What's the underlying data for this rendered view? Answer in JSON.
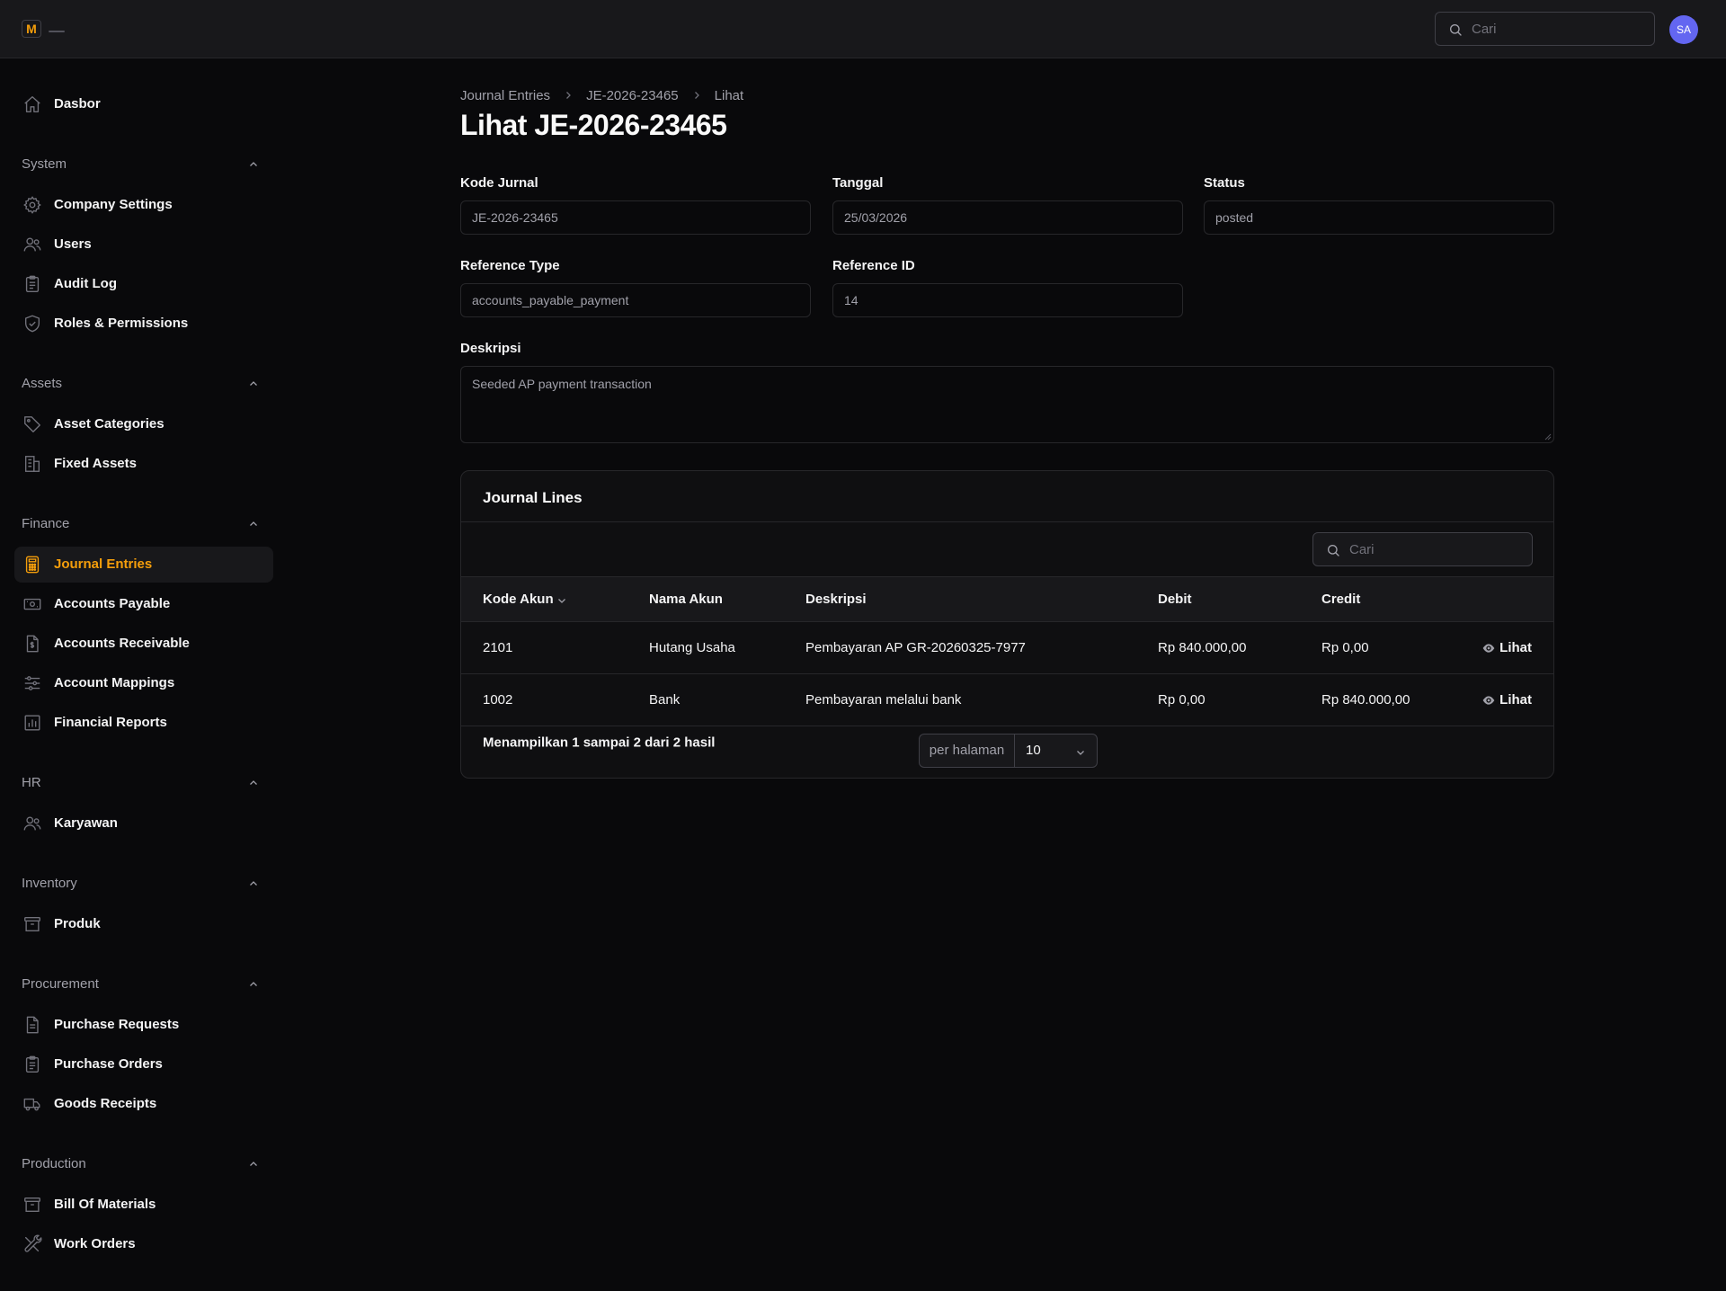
{
  "app": {
    "logo_letter": "M"
  },
  "header": {
    "search_placeholder": "Cari",
    "avatar_initials": "SA"
  },
  "sidebar": {
    "dashboard": {
      "label": "Dasbor",
      "icon": "home-icon"
    },
    "groups": [
      {
        "label": "System",
        "items": [
          {
            "label": "Company Settings",
            "icon": "gear-icon"
          },
          {
            "label": "Users",
            "icon": "users-icon"
          },
          {
            "label": "Audit Log",
            "icon": "clipboard-icon"
          },
          {
            "label": "Roles & Permissions",
            "icon": "shield-check-icon"
          }
        ]
      },
      {
        "label": "Assets",
        "items": [
          {
            "label": "Asset Categories",
            "icon": "tag-icon"
          },
          {
            "label": "Fixed Assets",
            "icon": "building-icon"
          }
        ]
      },
      {
        "label": "Finance",
        "items": [
          {
            "label": "Journal Entries",
            "icon": "calculator-icon",
            "active": true
          },
          {
            "label": "Accounts Payable",
            "icon": "banknotes-icon"
          },
          {
            "label": "Accounts Receivable",
            "icon": "document-dollar-icon"
          },
          {
            "label": "Account Mappings",
            "icon": "sliders-icon"
          },
          {
            "label": "Financial Reports",
            "icon": "chart-bar-icon"
          }
        ]
      },
      {
        "label": "HR",
        "items": [
          {
            "label": "Karyawan",
            "icon": "users-icon"
          }
        ]
      },
      {
        "label": "Inventory",
        "items": [
          {
            "label": "Produk",
            "icon": "archive-box-icon"
          }
        ]
      },
      {
        "label": "Procurement",
        "items": [
          {
            "label": "Purchase Requests",
            "icon": "document-text-icon"
          },
          {
            "label": "Purchase Orders",
            "icon": "clipboard-icon"
          },
          {
            "label": "Goods Receipts",
            "icon": "truck-icon"
          }
        ]
      },
      {
        "label": "Production",
        "items": [
          {
            "label": "Bill Of Materials",
            "icon": "archive-box-icon"
          },
          {
            "label": "Work Orders",
            "icon": "wrench-icon"
          }
        ]
      }
    ]
  },
  "breadcrumb": [
    "Journal Entries",
    "JE-2026-23465",
    "Lihat"
  ],
  "page_title": "Lihat JE-2026-23465",
  "form": {
    "kode_jurnal": {
      "label": "Kode Jurnal",
      "value": "JE-2026-23465"
    },
    "tanggal": {
      "label": "Tanggal",
      "value": "25/03/2026"
    },
    "status": {
      "label": "Status",
      "value": "posted"
    },
    "reference_type": {
      "label": "Reference Type",
      "value": "accounts_payable_payment"
    },
    "reference_id": {
      "label": "Reference ID",
      "value": "14"
    },
    "deskripsi": {
      "label": "Deskripsi",
      "value": "Seeded AP payment transaction"
    }
  },
  "journal_lines": {
    "title": "Journal Lines",
    "search_placeholder": "Cari",
    "columns": [
      "Kode Akun",
      "Nama Akun",
      "Deskripsi",
      "Debit",
      "Credit"
    ],
    "rows": [
      {
        "kode_akun": "2101",
        "nama_akun": "Hutang Usaha",
        "deskripsi": "Pembayaran AP GR-20260325-7977",
        "debit": "Rp 840.000,00",
        "credit": "Rp 0,00",
        "action": "Lihat"
      },
      {
        "kode_akun": "1002",
        "nama_akun": "Bank",
        "deskripsi": "Pembayaran melalui bank",
        "debit": "Rp 0,00",
        "credit": "Rp 840.000,00",
        "action": "Lihat"
      }
    ],
    "result_text": "Menampilkan 1 sampai 2 dari 2 hasil",
    "per_page_label": "per halaman",
    "per_page_value": "10"
  }
}
